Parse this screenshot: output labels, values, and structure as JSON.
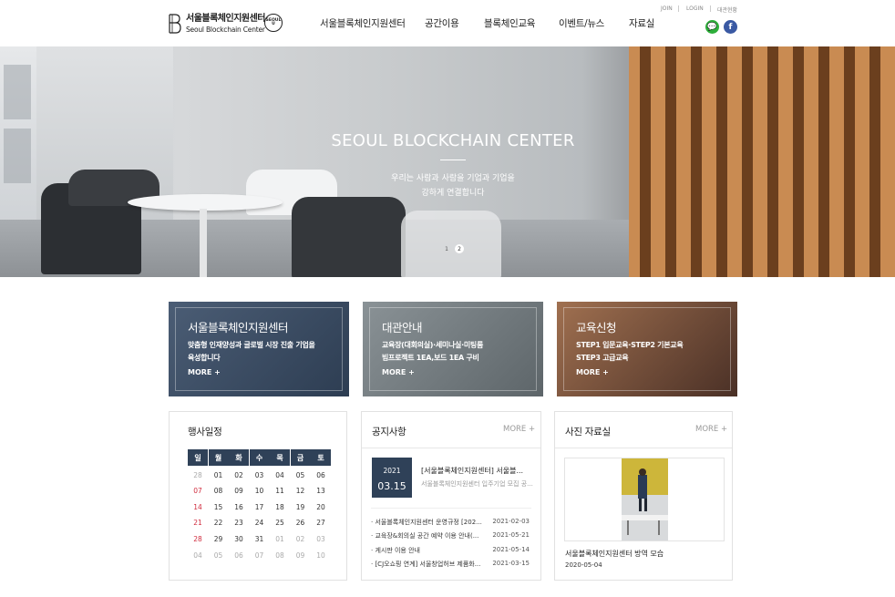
{
  "header": {
    "logo_kr": "서울블록체인지원센터",
    "logo_en": "Seoul Blockchain Center",
    "seal_top": "SEOUL",
    "seal_bottom": "U",
    "nav": [
      "서울블록체인지원센터",
      "공간이용",
      "블록체인교육",
      "이벤트/뉴스",
      "자료실"
    ],
    "util": {
      "join": "JOIN",
      "login": "LOGIN",
      "reserve": "대관현황"
    },
    "sns": [
      {
        "name": "kakao-talk",
        "color": "#2dae3a",
        "glyph": "💬"
      },
      {
        "name": "facebook",
        "color": "#3a59a3",
        "glyph": "f"
      }
    ]
  },
  "hero": {
    "title": "SEOUL BLOCKCHAIN CENTER",
    "sub1": "우리는 사람과 사람을 기업과 기업을",
    "sub2": "강하게 연결합니다",
    "dots": [
      "1",
      "2"
    ],
    "active_dot": 2
  },
  "cards": [
    {
      "title": "서울블록체인지원센터",
      "desc1": "맞춤형 인재양성과 글로벌 시장 진출 기업을",
      "desc2": "육성합니다",
      "more": "MORE  +",
      "bg": "#44556c"
    },
    {
      "title": "대관안내",
      "desc1": "교육장(대회의실)·세미나실·미팅룸",
      "desc2": "빔프로젝트 1EA,보드 1EA 구비",
      "more": "MORE  +",
      "bg": "#6d7579"
    },
    {
      "title": "교육신청",
      "desc1": "STEP1 입문교육·STEP2 기본교육",
      "desc2": "STEP3 고급교육",
      "more": "MORE  +",
      "bg": "#6b4a3b"
    }
  ],
  "schedule": {
    "title": "행사일정",
    "weekdays": [
      "일",
      "월",
      "화",
      "수",
      "목",
      "금",
      "토"
    ],
    "weeks": [
      [
        "28",
        "01",
        "02",
        "03",
        "04",
        "05",
        "06"
      ],
      [
        "07",
        "08",
        "09",
        "10",
        "11",
        "12",
        "13"
      ],
      [
        "14",
        "15",
        "16",
        "17",
        "18",
        "19",
        "20"
      ],
      [
        "21",
        "22",
        "23",
        "24",
        "25",
        "26",
        "27"
      ],
      [
        "28",
        "29",
        "30",
        "31",
        "01",
        "02",
        "03"
      ],
      [
        "04",
        "05",
        "06",
        "07",
        "08",
        "09",
        "10"
      ]
    ]
  },
  "notice": {
    "title": "공지사항",
    "more": "MORE  +",
    "featured": {
      "year": "2021",
      "md": "03.15",
      "title": "[서울블록체인지원센터] 서울블...",
      "desc": "서울블록체인지원센터 입주기업 모집 공..."
    },
    "items": [
      {
        "title": "· 서울블록체인지원센터 운영규정 [202...",
        "date": "2021-02-03"
      },
      {
        "title": "· 교육장&회의실 공간 예약 이용 안내(...",
        "date": "2021-05-21"
      },
      {
        "title": "· 게시판 이용 안내",
        "date": "2021-05-14"
      },
      {
        "title": "· [CJ오쇼핑 연계] 서울창업허브 제품화...",
        "date": "2021-03-15"
      }
    ]
  },
  "gallery": {
    "title": "사진 자료실",
    "more": "MORE  +",
    "caption": "서울블록체인지원센터 방역 모습",
    "date": "2020-05-04"
  }
}
